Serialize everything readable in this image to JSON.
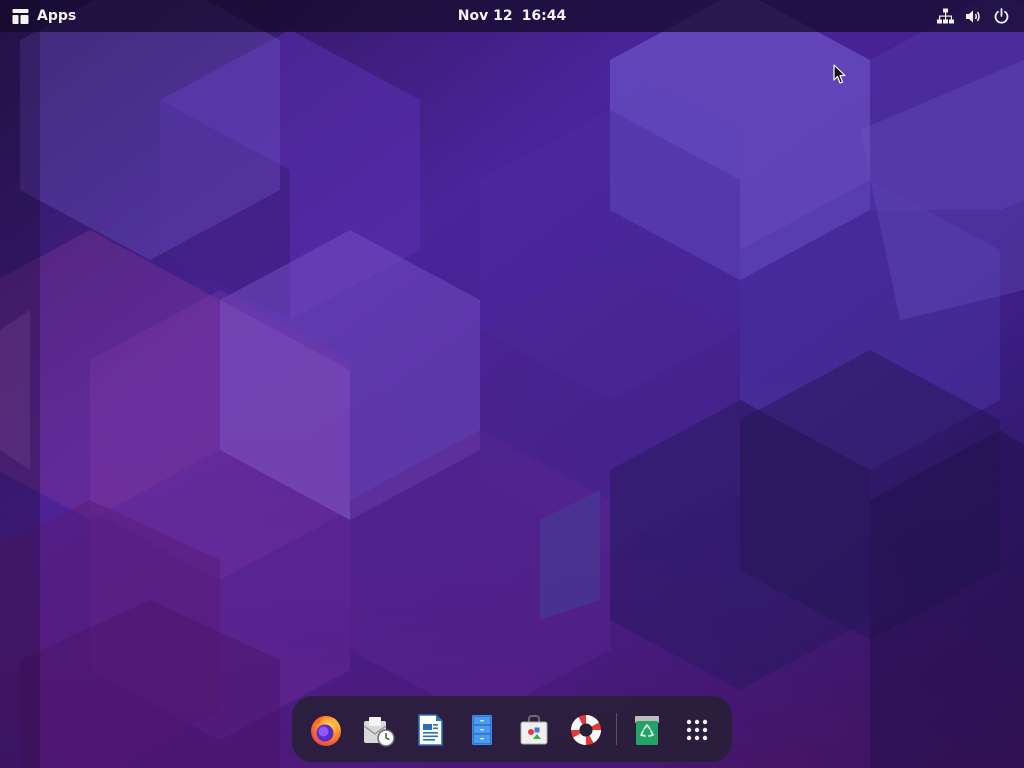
{
  "topbar": {
    "activities_label": "Apps",
    "clock": {
      "date": "Nov 12",
      "time": "16:44"
    },
    "status_icons": [
      "network-wired-icon",
      "volume-icon",
      "power-icon"
    ]
  },
  "dock": {
    "apps": [
      {
        "name": "Firefox",
        "icon": "firefox-icon"
      },
      {
        "name": "Evolution",
        "icon": "mail-clock-icon"
      },
      {
        "name": "LibreOffice Writer",
        "icon": "writer-document-icon"
      },
      {
        "name": "Files",
        "icon": "file-cabinet-icon"
      },
      {
        "name": "Software",
        "icon": "software-bag-icon"
      },
      {
        "name": "Help",
        "icon": "lifebuoy-icon"
      },
      {
        "name": "Trash",
        "icon": "trash-icon"
      }
    ],
    "show_apps_icon": "app-grid-icon"
  },
  "colors": {
    "topbar_bg": "#120a28",
    "wallpaper_base": "#3b1a78",
    "dock_bg": "#262034",
    "text": "#f2f2f2"
  }
}
